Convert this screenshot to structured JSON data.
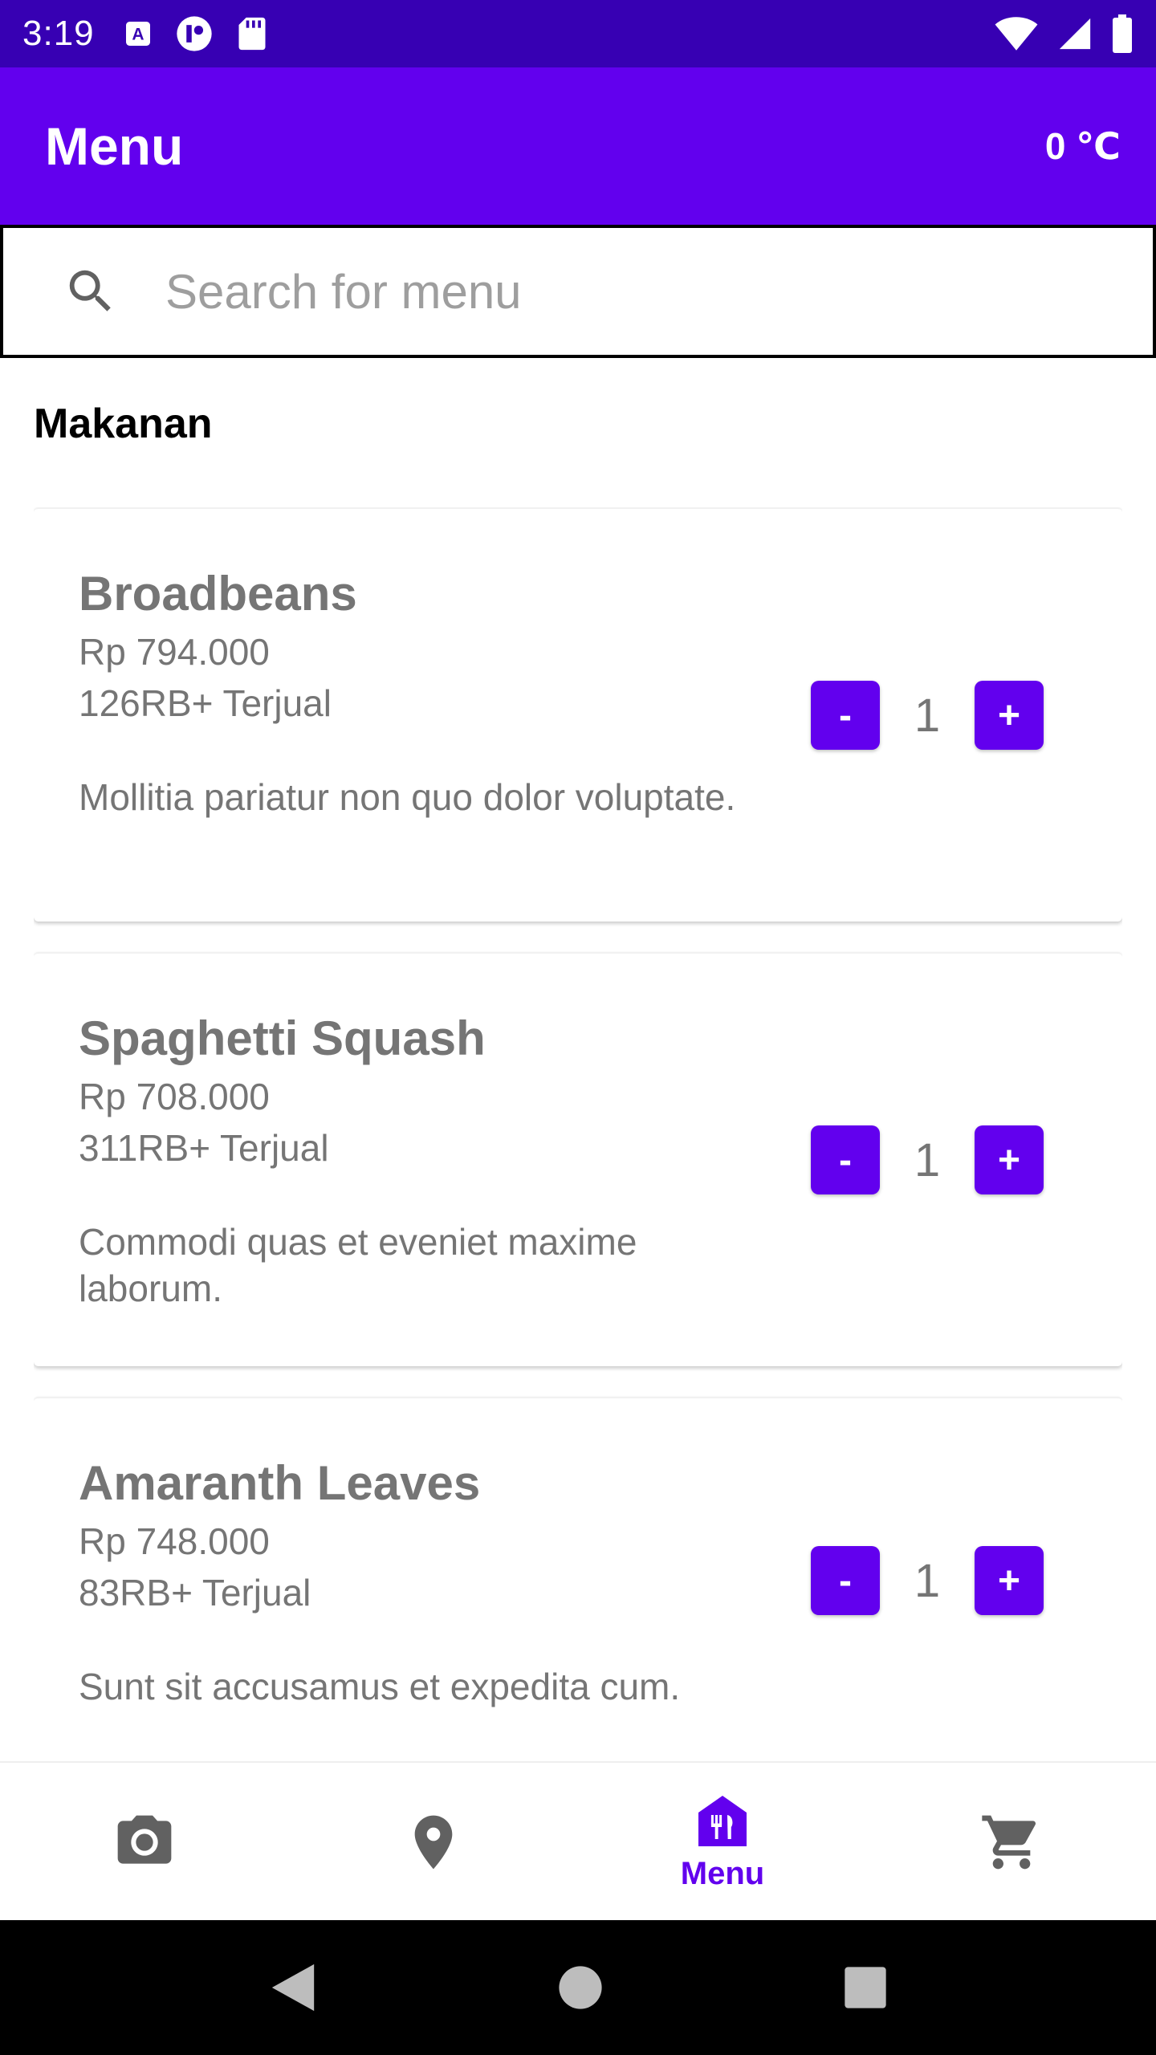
{
  "status_bar": {
    "time": "3:19",
    "icons": [
      "a-icon",
      "data-saver-icon",
      "sd-card-icon",
      "wifi-icon",
      "signal-icon",
      "battery-icon"
    ]
  },
  "app_bar": {
    "title": "Menu",
    "temperature": "0 ℃"
  },
  "search": {
    "placeholder": "Search for menu"
  },
  "section": {
    "title": "Makanan"
  },
  "menu_items": [
    {
      "name": "Broadbeans",
      "price": "Rp 794.000",
      "sold": "126RB+ Terjual",
      "description": "Mollitia pariatur non quo dolor voluptate.",
      "quantity": "1",
      "minus_label": "-",
      "plus_label": "+"
    },
    {
      "name": "Spaghetti Squash",
      "price": "Rp 708.000",
      "sold": "311RB+ Terjual",
      "description": "Commodi quas et eveniet maxime laborum.",
      "quantity": "1",
      "minus_label": "-",
      "plus_label": "+"
    },
    {
      "name": "Amaranth Leaves",
      "price": "Rp 748.000",
      "sold": "83RB+ Terjual",
      "description": "Sunt sit accusamus et expedita cum.",
      "quantity": "1",
      "minus_label": "-",
      "plus_label": "+"
    }
  ],
  "bottom_nav": {
    "items": [
      {
        "icon": "camera-icon",
        "label": ""
      },
      {
        "icon": "location-pin-icon",
        "label": ""
      },
      {
        "icon": "restaurant-menu-icon",
        "label": "Menu",
        "active": true
      },
      {
        "icon": "cart-icon",
        "label": ""
      }
    ]
  },
  "colors": {
    "status_bar": "#3700b3",
    "primary": "#6200ee",
    "text_secondary": "#757575",
    "icon_inactive": "#616161"
  }
}
